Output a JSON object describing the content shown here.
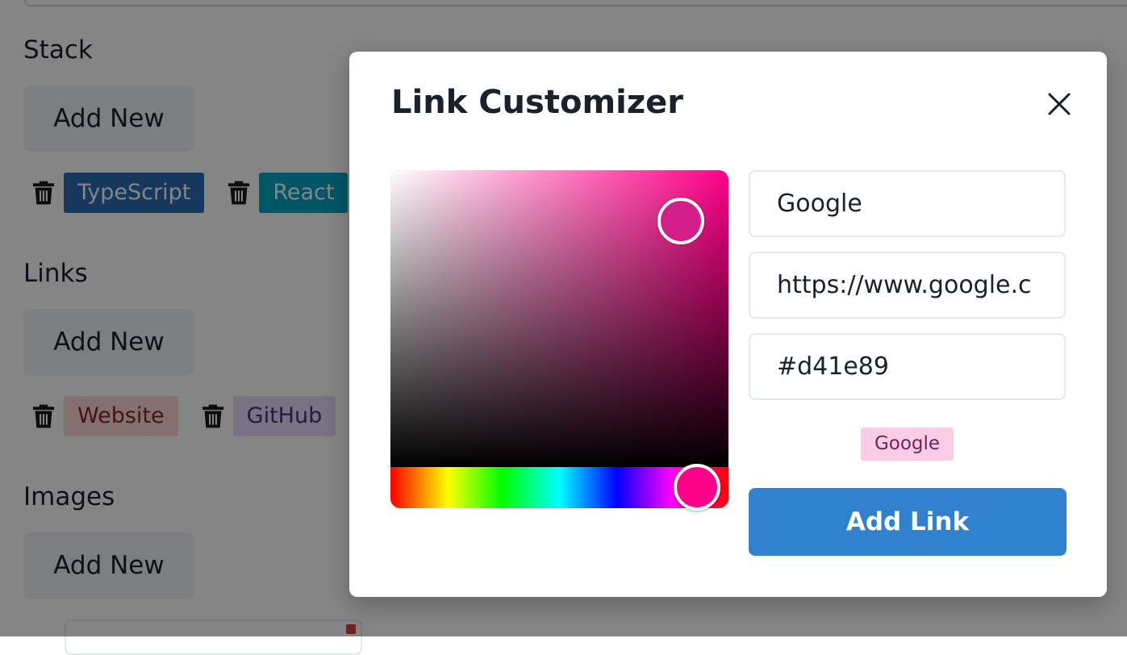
{
  "sections": {
    "stack": {
      "title": "Stack",
      "add_label": "Add New",
      "tags": [
        {
          "label": "TypeScript",
          "bg": "#2b6cb0",
          "fg": "#ffffff"
        },
        {
          "label": "React",
          "bg": "#00a3c4",
          "fg": "#ffffff"
        }
      ]
    },
    "links": {
      "title": "Links",
      "add_label": "Add New",
      "tags": [
        {
          "label": "Website",
          "bg": "#fed7d7",
          "fg": "#822727"
        },
        {
          "label": "GitHub",
          "bg": "#e9d8fd",
          "fg": "#44337a"
        }
      ]
    },
    "images": {
      "title": "Images",
      "add_label": "Add New"
    }
  },
  "icons": {
    "trash": "trash-icon",
    "close": "close-icon"
  },
  "modal": {
    "title": "Link Customizer",
    "name_value": "Google",
    "url_value": "https://www.google.c",
    "color_value": "#d41e89",
    "preview_label": "Google",
    "preview_bg": "#fbcce6",
    "preview_fg": "#702459",
    "submit_label": "Add Link",
    "submit_color": "#3182ce"
  },
  "color_picker": {
    "hue_color": "#ff0088",
    "saturation": 0.86,
    "brightness": 0.83,
    "hue_position": 0.906
  }
}
